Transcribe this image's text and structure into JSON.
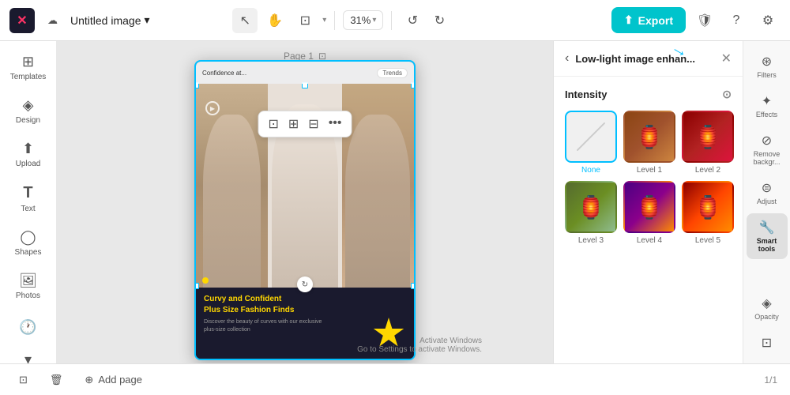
{
  "topbar": {
    "logo_text": "✕",
    "title": "Untitled image",
    "chevron": "▾",
    "zoom": "31%",
    "export_label": "Export",
    "upload_icon": "☁",
    "undo_icon": "↺",
    "redo_icon": "↻",
    "cursor_icon": "↖",
    "hand_icon": "✋",
    "frame_icon": "⊡",
    "arrow_down": "▾"
  },
  "left_sidebar": {
    "items": [
      {
        "id": "templates",
        "icon": "⊞",
        "label": "Templates"
      },
      {
        "id": "design",
        "icon": "🎨",
        "label": "Design"
      },
      {
        "id": "upload",
        "icon": "⬆",
        "label": "Upload"
      },
      {
        "id": "text",
        "icon": "T",
        "label": "Text"
      },
      {
        "id": "shapes",
        "icon": "◯",
        "label": "Shapes"
      },
      {
        "id": "photos",
        "icon": "🖼",
        "label": "Photos"
      }
    ],
    "bottom_items": [
      {
        "id": "clock",
        "icon": "🕐"
      },
      {
        "id": "chevron-down",
        "icon": "▾"
      }
    ]
  },
  "canvas": {
    "page_label": "Page 1",
    "confidence_text": "Confidence at...",
    "trends_badge": "Trends",
    "title_text": "Curvy and Confident\nPlus Size Fashion Finds",
    "subtitle_text": "Discover the beauty of curves with our exclusive\nplus-size collection",
    "toolbar_icons": [
      "⊡",
      "⊠",
      "⊟",
      "•••"
    ]
  },
  "panel": {
    "back_icon": "‹",
    "title": "Low-light image enhan...",
    "close_icon": "✕",
    "intensity_label": "Intensity",
    "adjust_icon": "⊙",
    "levels": [
      {
        "id": "none",
        "label": "None",
        "type": "none",
        "active": true
      },
      {
        "id": "level1",
        "label": "Level 1",
        "type": "bg1"
      },
      {
        "id": "level2",
        "label": "Level 2",
        "type": "bg2"
      },
      {
        "id": "level3",
        "label": "Level 3",
        "type": "bg3"
      },
      {
        "id": "level4",
        "label": "Level 4",
        "type": "bg4"
      },
      {
        "id": "level5",
        "label": "Level 5",
        "type": "bg5"
      }
    ]
  },
  "right_sidebar": {
    "tools": [
      {
        "id": "filters",
        "icon": "⊛",
        "label": "Filters"
      },
      {
        "id": "effects",
        "icon": "✦",
        "label": "Effects"
      },
      {
        "id": "remove-bg",
        "icon": "⊘",
        "label": "Remove backgr..."
      },
      {
        "id": "adjust",
        "icon": "⊜",
        "label": "Adjust"
      },
      {
        "id": "smart-tools",
        "icon": "🔧",
        "label": "Smart tools"
      },
      {
        "id": "opacity",
        "icon": "◈",
        "label": "Opacity"
      },
      {
        "id": "more",
        "icon": "⊡",
        "label": ""
      }
    ]
  },
  "bottom_bar": {
    "duplicate_icon": "⊡",
    "delete_icon": "🗑",
    "add_page_label": "Add page",
    "page_counter": "1/1",
    "activate_line1": "Activate Windows",
    "activate_line2": "Go to Settings to activate Windows."
  },
  "arrows": {
    "arrow1": "➜",
    "arrow2": "➜"
  }
}
